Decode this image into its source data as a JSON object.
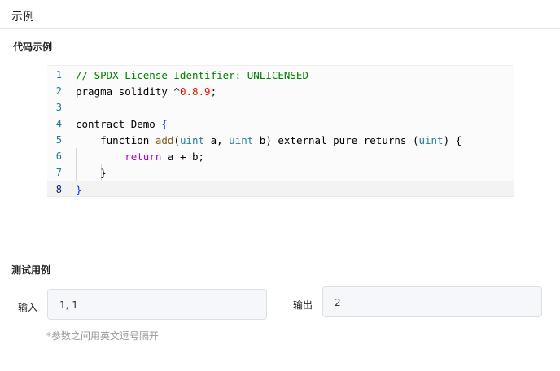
{
  "header": {
    "title": "示例"
  },
  "code_example": {
    "label": "代码示例",
    "lines": [
      {
        "no": "1",
        "segments": [
          {
            "text": "// SPDX-License-Identifier: UNLICENSED",
            "cls": "t-comment"
          }
        ]
      },
      {
        "no": "2",
        "segments": [
          {
            "text": "pragma solidity ^",
            "cls": ""
          },
          {
            "text": "0.8.9",
            "cls": "t-num"
          },
          {
            "text": ";",
            "cls": ""
          }
        ]
      },
      {
        "no": "3",
        "segments": []
      },
      {
        "no": "4",
        "segments": [
          {
            "text": "contract Demo ",
            "cls": ""
          },
          {
            "text": "{",
            "cls": "t-brace"
          }
        ]
      },
      {
        "no": "5",
        "segments": [
          {
            "text": "    function ",
            "cls": ""
          },
          {
            "text": "add",
            "cls": "t-fn"
          },
          {
            "text": "(",
            "cls": ""
          },
          {
            "text": "uint",
            "cls": "t-type"
          },
          {
            "text": " a, ",
            "cls": ""
          },
          {
            "text": "uint",
            "cls": "t-type"
          },
          {
            "text": " b) external pure returns (",
            "cls": ""
          },
          {
            "text": "uint",
            "cls": "t-type"
          },
          {
            "text": ") {",
            "cls": ""
          }
        ]
      },
      {
        "no": "6",
        "segments": [
          {
            "text": "        ",
            "cls": ""
          },
          {
            "text": "return",
            "cls": "t-kw"
          },
          {
            "text": " a + b;",
            "cls": ""
          }
        ]
      },
      {
        "no": "7",
        "segments": [
          {
            "text": "    }",
            "cls": ""
          }
        ]
      },
      {
        "no": "8",
        "segments": [
          {
            "text": "}",
            "cls": "t-brace"
          }
        ]
      }
    ]
  },
  "test_case": {
    "label": "测试用例",
    "input_label": "输入",
    "input_value": "1, 1",
    "output_label": "输出",
    "output_value": "2",
    "hint": "*参数之间用英文逗号隔开"
  }
}
